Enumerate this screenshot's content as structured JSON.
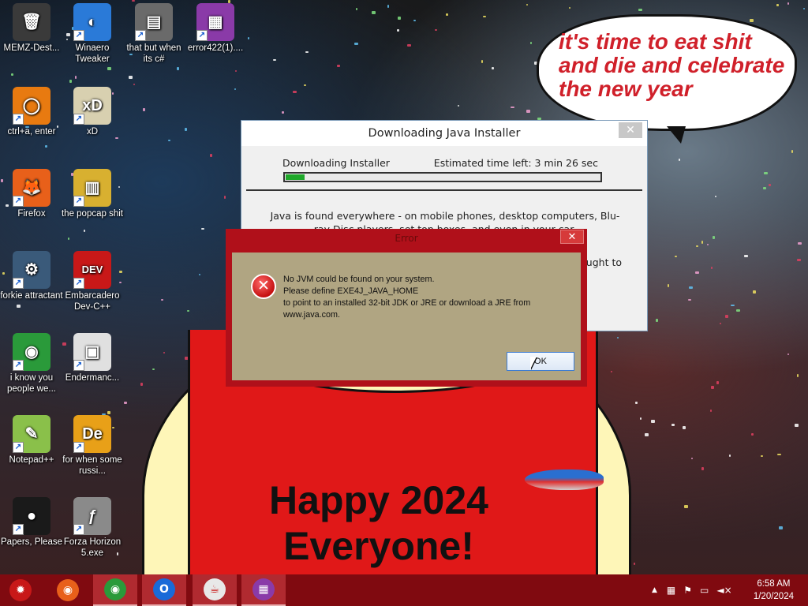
{
  "desktop": {
    "icons": [
      {
        "label": "MEMZ-Dest...",
        "glyph": "🗑",
        "bg": "#3a3a3a"
      },
      {
        "label": "Winaero Tweaker",
        "glyph": "◐",
        "bg": "#2a7ad8"
      },
      {
        "label": "that but when its c#",
        "glyph": "▤",
        "bg": "#6a6a6a"
      },
      {
        "label": "error422(1)....",
        "glyph": "▦",
        "bg": "#8a3aa8"
      },
      {
        "label": "ctrl+a, enter",
        "glyph": "◯",
        "bg": "#e87a10"
      },
      {
        "label": "xD",
        "glyph": "xD",
        "bg": "#d8d0b0"
      },
      {
        "label": "Firefox",
        "glyph": "🦊",
        "bg": "#e8601a"
      },
      {
        "label": "the popcap shit",
        "glyph": "▥",
        "bg": "#d8b030"
      },
      {
        "label": "forkie attractant",
        "glyph": "⚙",
        "bg": "#3a5a7a"
      },
      {
        "label": "Embarcadero Dev-C++",
        "glyph": "DEV",
        "bg": "#c81818"
      },
      {
        "label": "i know you people we...",
        "glyph": "◉",
        "bg": "#2a9a3a"
      },
      {
        "label": "Endermanc...",
        "glyph": "▣",
        "bg": "#e0e0e0"
      },
      {
        "label": "Notepad++",
        "glyph": "✎",
        "bg": "#8ac04a"
      },
      {
        "label": "for when some russi...",
        "glyph": "De",
        "bg": "#e8a018"
      },
      {
        "label": "Papers, Please",
        "glyph": "●",
        "bg": "#1a1a1a"
      },
      {
        "label": "Forza Horizon 5.exe",
        "glyph": "ƒ",
        "bg": "#8a8a8a"
      }
    ]
  },
  "wallpaper": {
    "bubble_text": "it's time to eat shit and die and celebrate the new year",
    "banner": "Happy 2024 Everyone!"
  },
  "java_window": {
    "title": "Downloading Java Installer",
    "close": "✕",
    "status": "Downloading Installer",
    "eta": "Estimated time left: 3 min 26 sec",
    "progress": 0.06,
    "description": "Java is found everywhere - on mobile phones, desktop computers, Blu-ray Disc players, set top boxes, and even in your car.",
    "extra": "ught to"
  },
  "error_dialog": {
    "title": "Error",
    "close": "✕",
    "icon": "✕",
    "line1": "No JVM could be found on your system.",
    "line2": "Please define EXE4J_JAVA_HOME",
    "line3": "to point to an installed 32-bit JDK or JRE or download a JRE from",
    "line4": "www.java.com.",
    "ok": "OK"
  },
  "taskbar": {
    "start": "✹",
    "apps": [
      {
        "name": "firefox",
        "glyph": "◉",
        "color": "#e8601a"
      },
      {
        "name": "chrome",
        "glyph": "◉",
        "color": "#2a9a3a"
      },
      {
        "name": "outlook",
        "glyph": "O",
        "color": "#1a6ad8"
      },
      {
        "name": "java",
        "glyph": "☕",
        "color": "#e8e8e8"
      },
      {
        "name": "error422",
        "glyph": "▦",
        "color": "#8a3aa8"
      }
    ],
    "tray_chevron": "▲",
    "time": "6:58 AM",
    "date": "1/20/2024"
  }
}
